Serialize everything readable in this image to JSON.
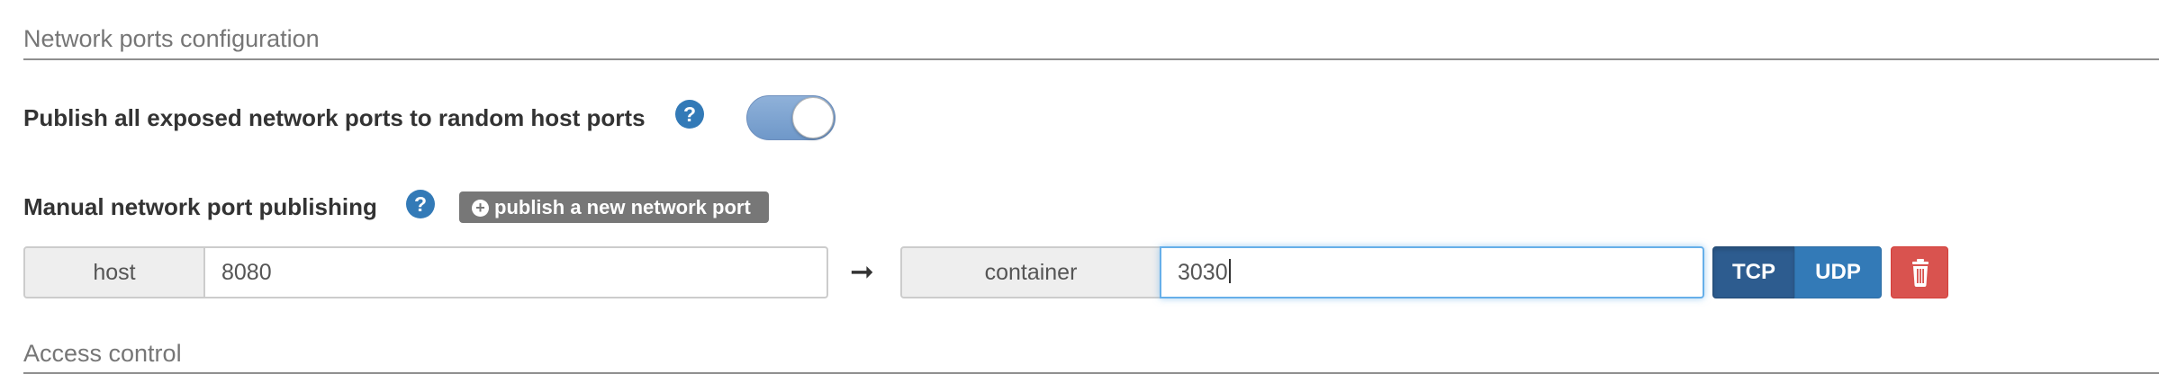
{
  "ports_section": {
    "title": "Network ports configuration",
    "publish_all_label": "Publish all exposed network ports to random host ports",
    "publish_all_help": "?",
    "publish_all_enabled": true,
    "manual_label": "Manual network port publishing",
    "manual_help": "?",
    "publish_new_button": "publish a new network port",
    "mapping": {
      "host_label": "host",
      "host_value": "8080",
      "arrow": "➞",
      "container_label": "container",
      "container_value": "3030",
      "protocols": [
        "TCP",
        "UDP"
      ],
      "selected_protocol": "TCP",
      "delete_icon": "trash-icon"
    }
  },
  "access_section": {
    "title": "Access control"
  },
  "colors": {
    "primary": "#337ab7",
    "primary_active": "#2d5c8f",
    "danger": "#d9534f",
    "default_gray": "#777777",
    "toggle_on": "#7ea4d2"
  }
}
